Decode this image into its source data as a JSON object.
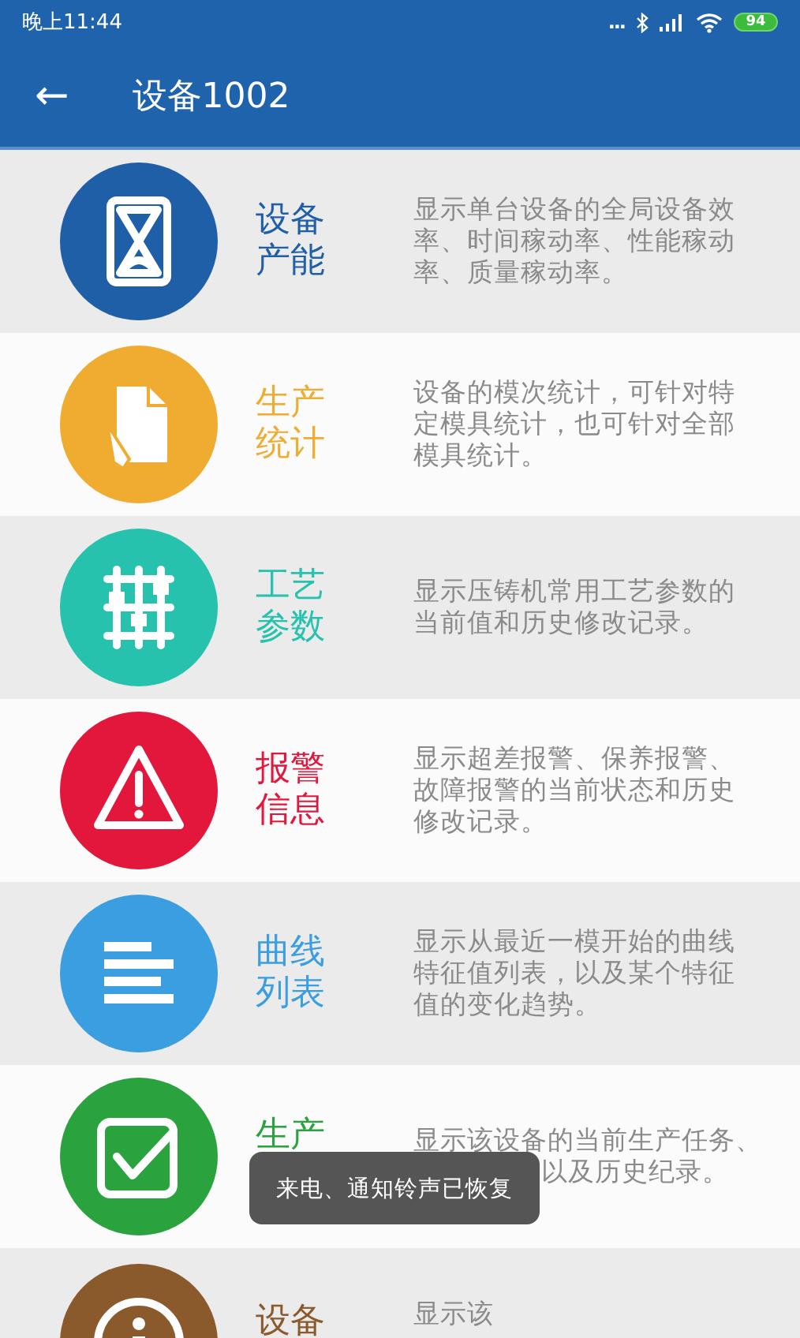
{
  "status_bar": {
    "time": "晚上11:44",
    "dots": "...",
    "battery": "94"
  },
  "app_bar": {
    "back": "←",
    "title": "设备1002"
  },
  "items": [
    {
      "title": "设备产能",
      "color": "#1f5fa8",
      "description": "显示单台设备的全局设备效率、时间稼动率、性能稼动率、质量稼动率。"
    },
    {
      "title": "生产统计",
      "color": "#f0ac30",
      "description": "设备的模次统计，可针对特定模具统计，也可针对全部模具统计。"
    },
    {
      "title": "工艺参数",
      "color": "#27c2ad",
      "description": "显示压铸机常用工艺参数的当前值和历史修改记录。"
    },
    {
      "title": "报警信息",
      "color": "#e3173c",
      "description": "显示超差报警、保养报警、故障报警的当前状态和历史修改记录。"
    },
    {
      "title": "曲线列表",
      "color": "#3a9ee0",
      "description": "显示从最近一模开始的曲线特征值列表，以及某个特征值的变化趋势。"
    },
    {
      "title": "生产",
      "color": "#2aa33e",
      "description": "显示该设备的当前生产任务、",
      "description_tail": "以及历史纪录。"
    },
    {
      "title": "设备",
      "color": "#8a5a2c",
      "description": "显示该"
    }
  ],
  "toast": "来电、通知铃声已恢复"
}
